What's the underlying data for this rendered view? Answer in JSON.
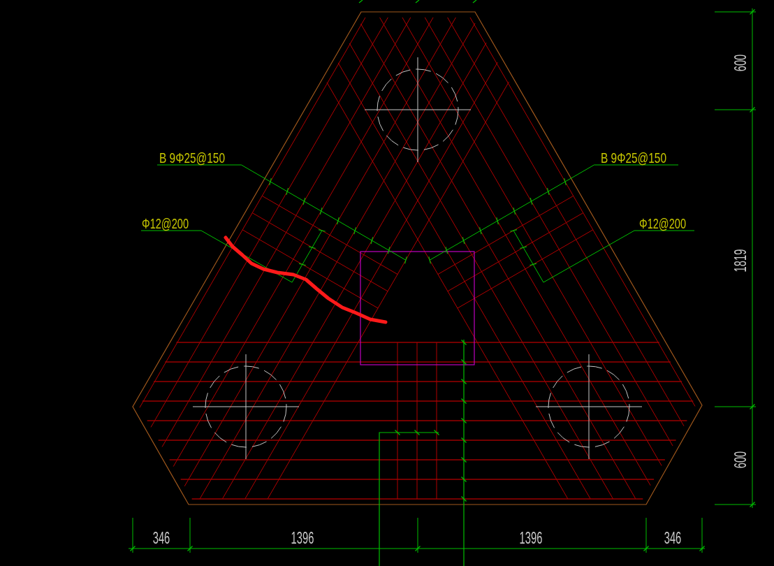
{
  "rebar_labels": [
    {
      "text": "B 9Φ25@150"
    },
    {
      "text": "B 9Φ25@150"
    },
    {
      "text": "Φ12@200"
    },
    {
      "text": "Φ12@200"
    }
  ],
  "right_dimensions": [
    "600",
    "1819",
    "600"
  ],
  "bottom_dimensions": [
    "346",
    "1396",
    "1396",
    "346"
  ]
}
